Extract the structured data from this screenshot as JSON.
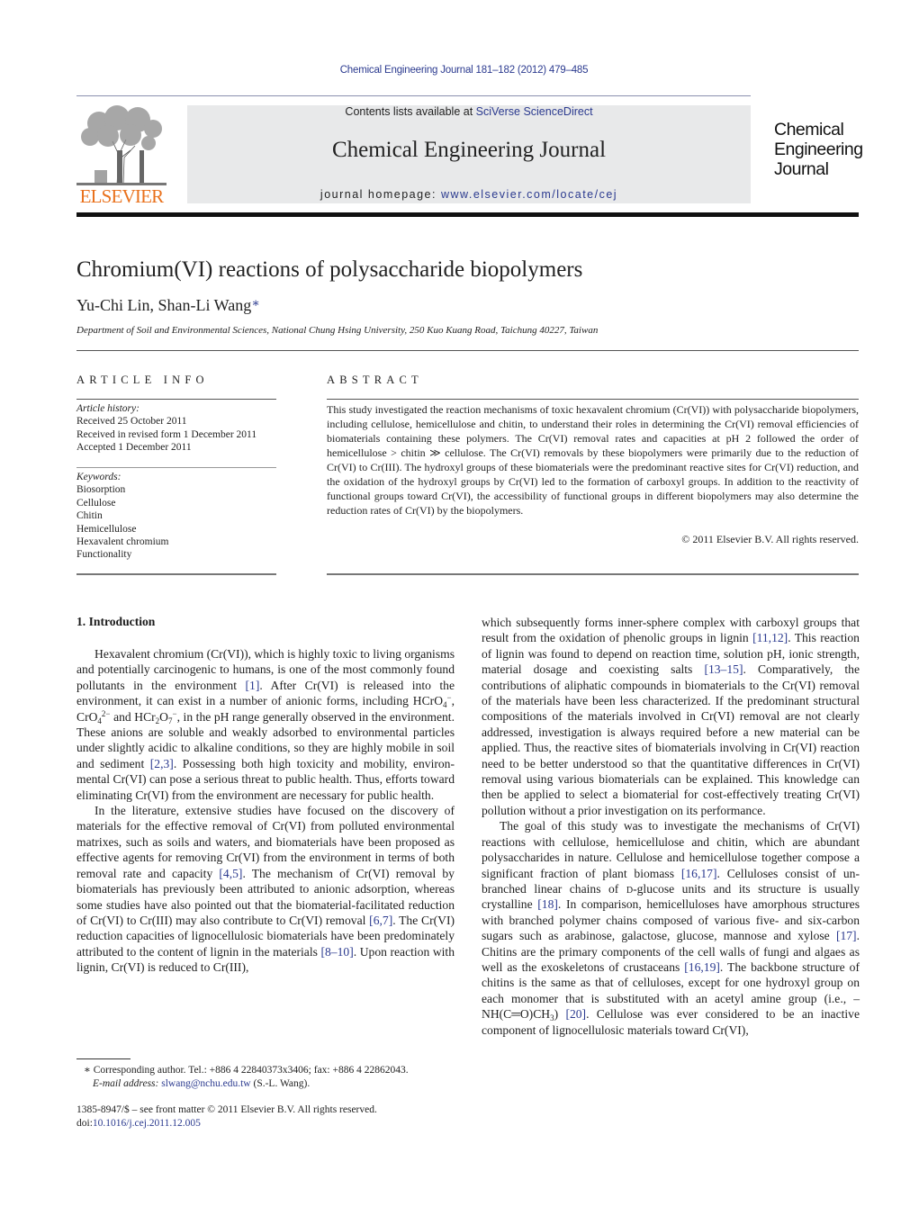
{
  "running_head": "Chemical Engineering Journal 181–182 (2012) 479–485",
  "masthead": {
    "publisher_logo_text": "ELSEVIER",
    "contents_prefix": "Contents lists available at ",
    "contents_link": "SciVerse ScienceDirect",
    "journal_name": "Chemical Engineering Journal",
    "homepage_prefix": "journal homepage: ",
    "homepage_link": "www.elsevier.com/locate/cej",
    "cover_title_lines": [
      "Chemical",
      "Engineering",
      "Journal"
    ]
  },
  "article": {
    "title": "Chromium(VI) reactions of polysaccharide biopolymers",
    "authors": "Yu-Chi Lin, Shan-Li Wang",
    "author_mark": "∗",
    "affiliation": "Department of Soil and Environmental Sciences, National Chung Hsing University, 250 Kuo Kuang Road, Taichung 40227, Taiwan"
  },
  "article_info": {
    "heading": "ARTICLE INFO",
    "history_label": "Article history:",
    "history": [
      "Received 25 October 2011",
      "Received in revised form 1 December 2011",
      "Accepted 1 December 2011"
    ],
    "keywords_label": "Keywords:",
    "keywords": [
      "Biosorption",
      "Cellulose",
      "Chitin",
      "Hemicellulose",
      "Hexavalent chromium",
      "Functionality"
    ]
  },
  "abstract": {
    "heading": "ABSTRACT",
    "text": "This study investigated the reaction mechanisms of toxic hexavalent chromium (Cr(VI)) with polysaccha­ride biopolymers, including cellulose, hemicellulose and chitin, to understand their roles in determining the Cr(VI) removal efficiencies of biomaterials containing these polymers. The Cr(VI) removal rates and capacities at pH 2 followed the order of hemicellulose > chitin ≫ cellulose. The Cr(VI) removals by these biopolymers were primarily due to the reduction of Cr(VI) to Cr(III). The hydroxyl groups of these bioma­terials were the predominant reactive sites for Cr(VI) reduction, and the oxidation of the hydroxyl groups by Cr(VI) led to the formation of carboxyl groups. In addition to the reactivity of functional groups toward Cr(VI), the accessibility of functional groups in different biopolymers may also determine the reduction rates of Cr(VI) by the biopolymers.",
    "copyright": "© 2011 Elsevier B.V. All rights reserved."
  },
  "body": {
    "section_heading": "1.  Introduction",
    "left": {
      "p1_a": "Hexavalent chromium (Cr(VI)), which is highly toxic to living organisms and potentially carcinogenic to humans, is one of the most commonly found pollutants in the environment ",
      "p1_ref1": "[1]",
      "p1_b": ". After Cr(VI) is released into the environment, it can exist in a number of anionic forms, including HCrO",
      "p1_c": ", CrO",
      "p1_d": " and HCr",
      "p1_e": "O",
      "p1_f": ", in the pH range generally observed in the environment. These anions are sol­uble and weakly adsorbed to environmental particles under slightly acidic to alkaline conditions, so they are highly mobile in soil and sediment ",
      "p1_ref2": "[2,3]",
      "p1_g": ". Possessing both high toxicity and mobility, environ­mental Cr(VI) can pose a serious threat to public health. Thus, efforts toward eliminating Cr(VI) from the environment are necessary for public health.",
      "sub4": "4",
      "sup_minus": "−",
      "sup_2minus": "2−",
      "sub2": "2",
      "sub7": "7",
      "p2_a": "In the literature, extensive studies have focused on the discov­ery of materials for the effective removal of Cr(VI) from polluted environmental matrixes, such as soils and waters, and biomate­rials have been proposed as effective agents for removing Cr(VI) from the environment in terms of both removal rate and capac­ity ",
      "p2_ref1": "[4,5]",
      "p2_b": ". The mechanism of Cr(VI) removal by biomaterials has previously been attributed to anionic adsorption, whereas some studies have also pointed out that the biomaterial-facilitated reduc­tion of Cr(VI) to Cr(III) may also contribute to Cr(VI) removal ",
      "p2_ref2": "[6,7]",
      "p2_c": ". The Cr(VI) reduction capacities of lignocellulosic biomaterials have been predominately attributed to the content of lignin in the mate­rials ",
      "p2_ref3": "[8–10]",
      "p2_d": ". Upon reaction with lignin, Cr(VI) is reduced to Cr(III),"
    },
    "right": {
      "p1_a": "which subsequently forms inner-sphere complex with carboxyl groups that result from the oxidation of phenolic groups in lignin ",
      "p1_ref1": "[11,12]",
      "p1_b": ". This reaction of lignin was found to depend on reaction time, solution pH, ionic strength, material dosage and coexisting salts ",
      "p1_ref2": "[13–15]",
      "p1_c": ". Comparatively, the contributions of aliphatic com­pounds in biomaterials to the Cr(VI) removal of the materials have been less characterized. If the predominant structural composi­tions of the materials involved in Cr(VI) removal are not clearly addressed, investigation is always required before a new material can be applied. Thus, the reactive sites of biomaterials involving in Cr(VI) reaction need to be better understood so that the quantita­tive differences in Cr(VI) removal using various biomaterials can be explained. This knowledge can then be applied to select a bioma­terial for cost-effectively treating Cr(VI) pollution without a prior investigation on its performance.",
      "p2_a": "The goal of this study was to investigate the mechanisms of Cr(VI) reactions with cellulose, hemicellulose and chitin, which are abundant polysaccharides in nature. Cellulose and hemicellulose together compose a significant fraction of plant biomass ",
      "p2_ref1": "[16,17]",
      "p2_b": ". Celluloses consist of un-branched linear chains of ",
      "p2_d_glucose_prefix": "d",
      "p2_c": "-glucose units and its structure is usually crystalline ",
      "p2_ref2": "[18]",
      "p2_d": ". In comparison, hemicel­luloses have amorphous structures with branched polymer chains composed of various five- and six-carbon sugars such as arabinose, galactose, glucose, mannose and xylose ",
      "p2_ref3": "[17]",
      "p2_e": ". Chitins are the pri­mary components of the cell walls of fungi and algaes as well as the exoskeletons of crustaceans ",
      "p2_ref4": "[16,19]",
      "p2_f": ". The backbone structure of chitins is the same as that of celluloses, except for one hydroxyl group on each monomer that is substituted with an acetyl amine group (i.e., –NH(C═O)CH",
      "p2_sub3": "3",
      "p2_g": ") ",
      "p2_ref5": "[20]",
      "p2_h": ". Cellulose was ever considered to be an inactive component of lignocellulosic materials toward Cr(VI),"
    }
  },
  "footnote": {
    "mark": "∗",
    "text": " Corresponding author. Tel.: +886 4 22840373x3406; fax: +886 4 22862043.",
    "email_label": "E-mail address: ",
    "email": "slwang@nchu.edu.tw",
    "email_suffix": " (S.-L. Wang)."
  },
  "front_matter": {
    "issn_line": "1385-8947/$ – see front matter © 2011 Elsevier B.V. All rights reserved.",
    "doi_prefix": "doi:",
    "doi": "10.1016/j.cej.2011.12.005"
  },
  "colors": {
    "link": "#2b3a8f",
    "elsevier_orange": "#e9711c",
    "masthead_gray": "#e8e9ea"
  }
}
